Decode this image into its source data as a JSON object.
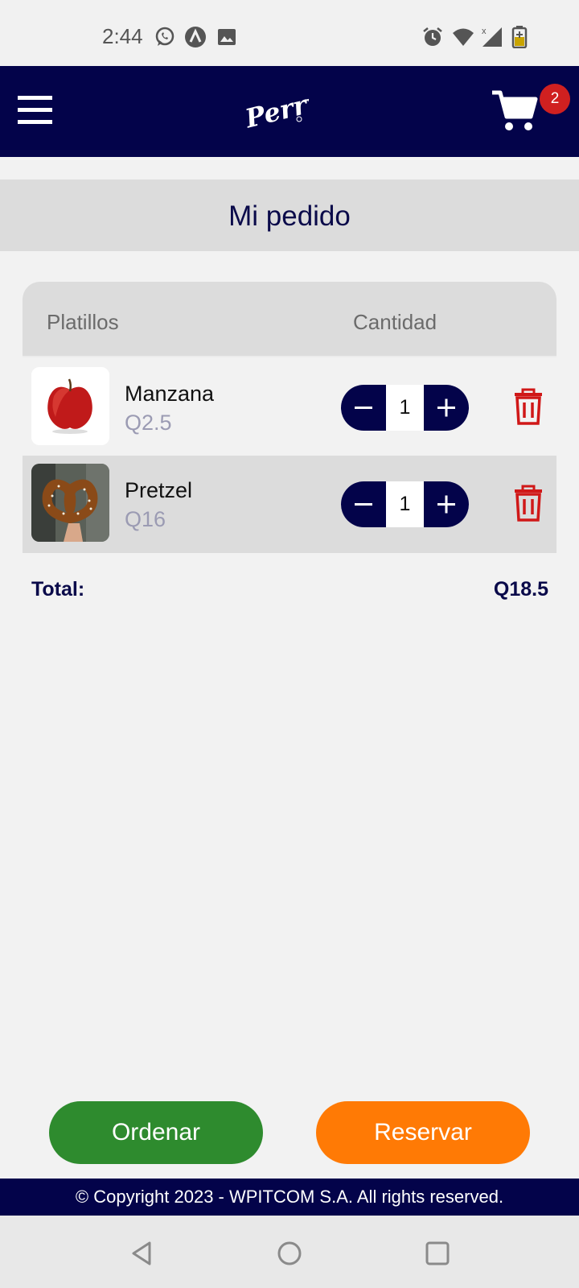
{
  "status_bar": {
    "time": "2:44",
    "icons": [
      "whatsapp-icon",
      "app-icon",
      "image-icon",
      "alarm-icon",
      "wifi-icon",
      "signal-icon",
      "battery-icon"
    ]
  },
  "header": {
    "logo_text": "Perry",
    "cart_count": "2",
    "brand_color": "#03034a"
  },
  "page": {
    "title": "Mi pedido"
  },
  "table": {
    "headers": {
      "platillos": "Platillos",
      "cantidad": "Cantidad"
    },
    "items": [
      {
        "name": "Manzana",
        "price": "Q2.5",
        "quantity": "1"
      },
      {
        "name": "Pretzel",
        "price": "Q16",
        "quantity": "1"
      }
    ]
  },
  "total": {
    "label": "Total:",
    "value": "Q18.5"
  },
  "actions": {
    "order_label": "Ordenar",
    "reserve_label": "Reservar",
    "order_color": "#2e8b2e",
    "reserve_color": "#ff7a05"
  },
  "footer": {
    "copyright": "© Copyright 2023 - WPITCOM S.A. All rights reserved."
  }
}
